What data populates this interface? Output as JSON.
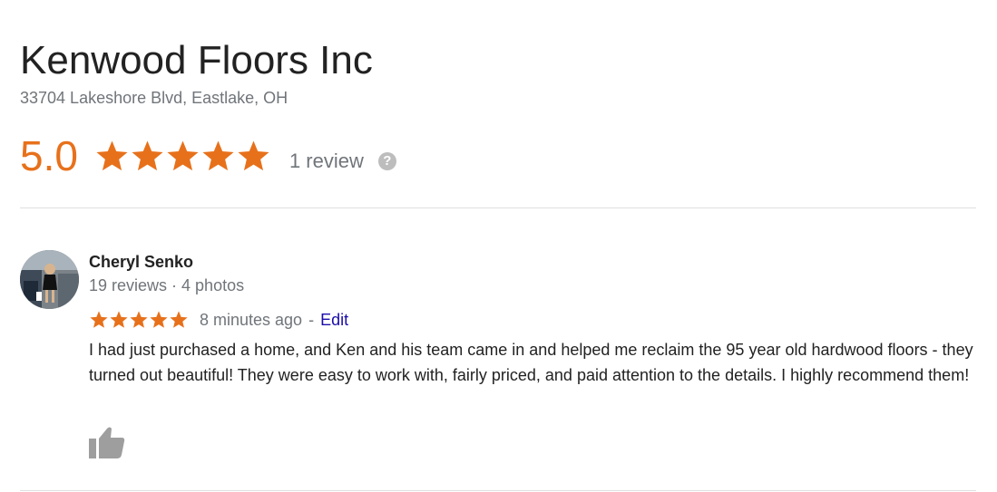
{
  "business": {
    "name": "Kenwood Floors Inc",
    "address": "33704 Lakeshore Blvd, Eastlake, OH",
    "rating_value": "5.0",
    "rating_stars": 5,
    "review_count_label": "1 review",
    "help_icon": "help-circle-icon",
    "help_glyph": "?"
  },
  "review": {
    "reviewer_name": "Cheryl Senko",
    "reviewer_stats": "19 reviews · 4 photos",
    "avatar_icon": "reviewer-photo",
    "stars": 5,
    "time": "8 minutes ago",
    "separator": "-",
    "edit_label": "Edit",
    "text": "I had just purchased a home, and Ken and his team came in and helped me reclaim the 95 year old hardwood floors - they turned out beautiful! They were easy to work with, fairly priced, and paid attention to the details. I highly recommend them!",
    "like_icon": "thumbs-up-icon"
  },
  "colors": {
    "star": "#e7711b",
    "link": "#1a0dab",
    "muted": "#70757a",
    "text": "#222222",
    "divider": "#e0e0e0"
  }
}
